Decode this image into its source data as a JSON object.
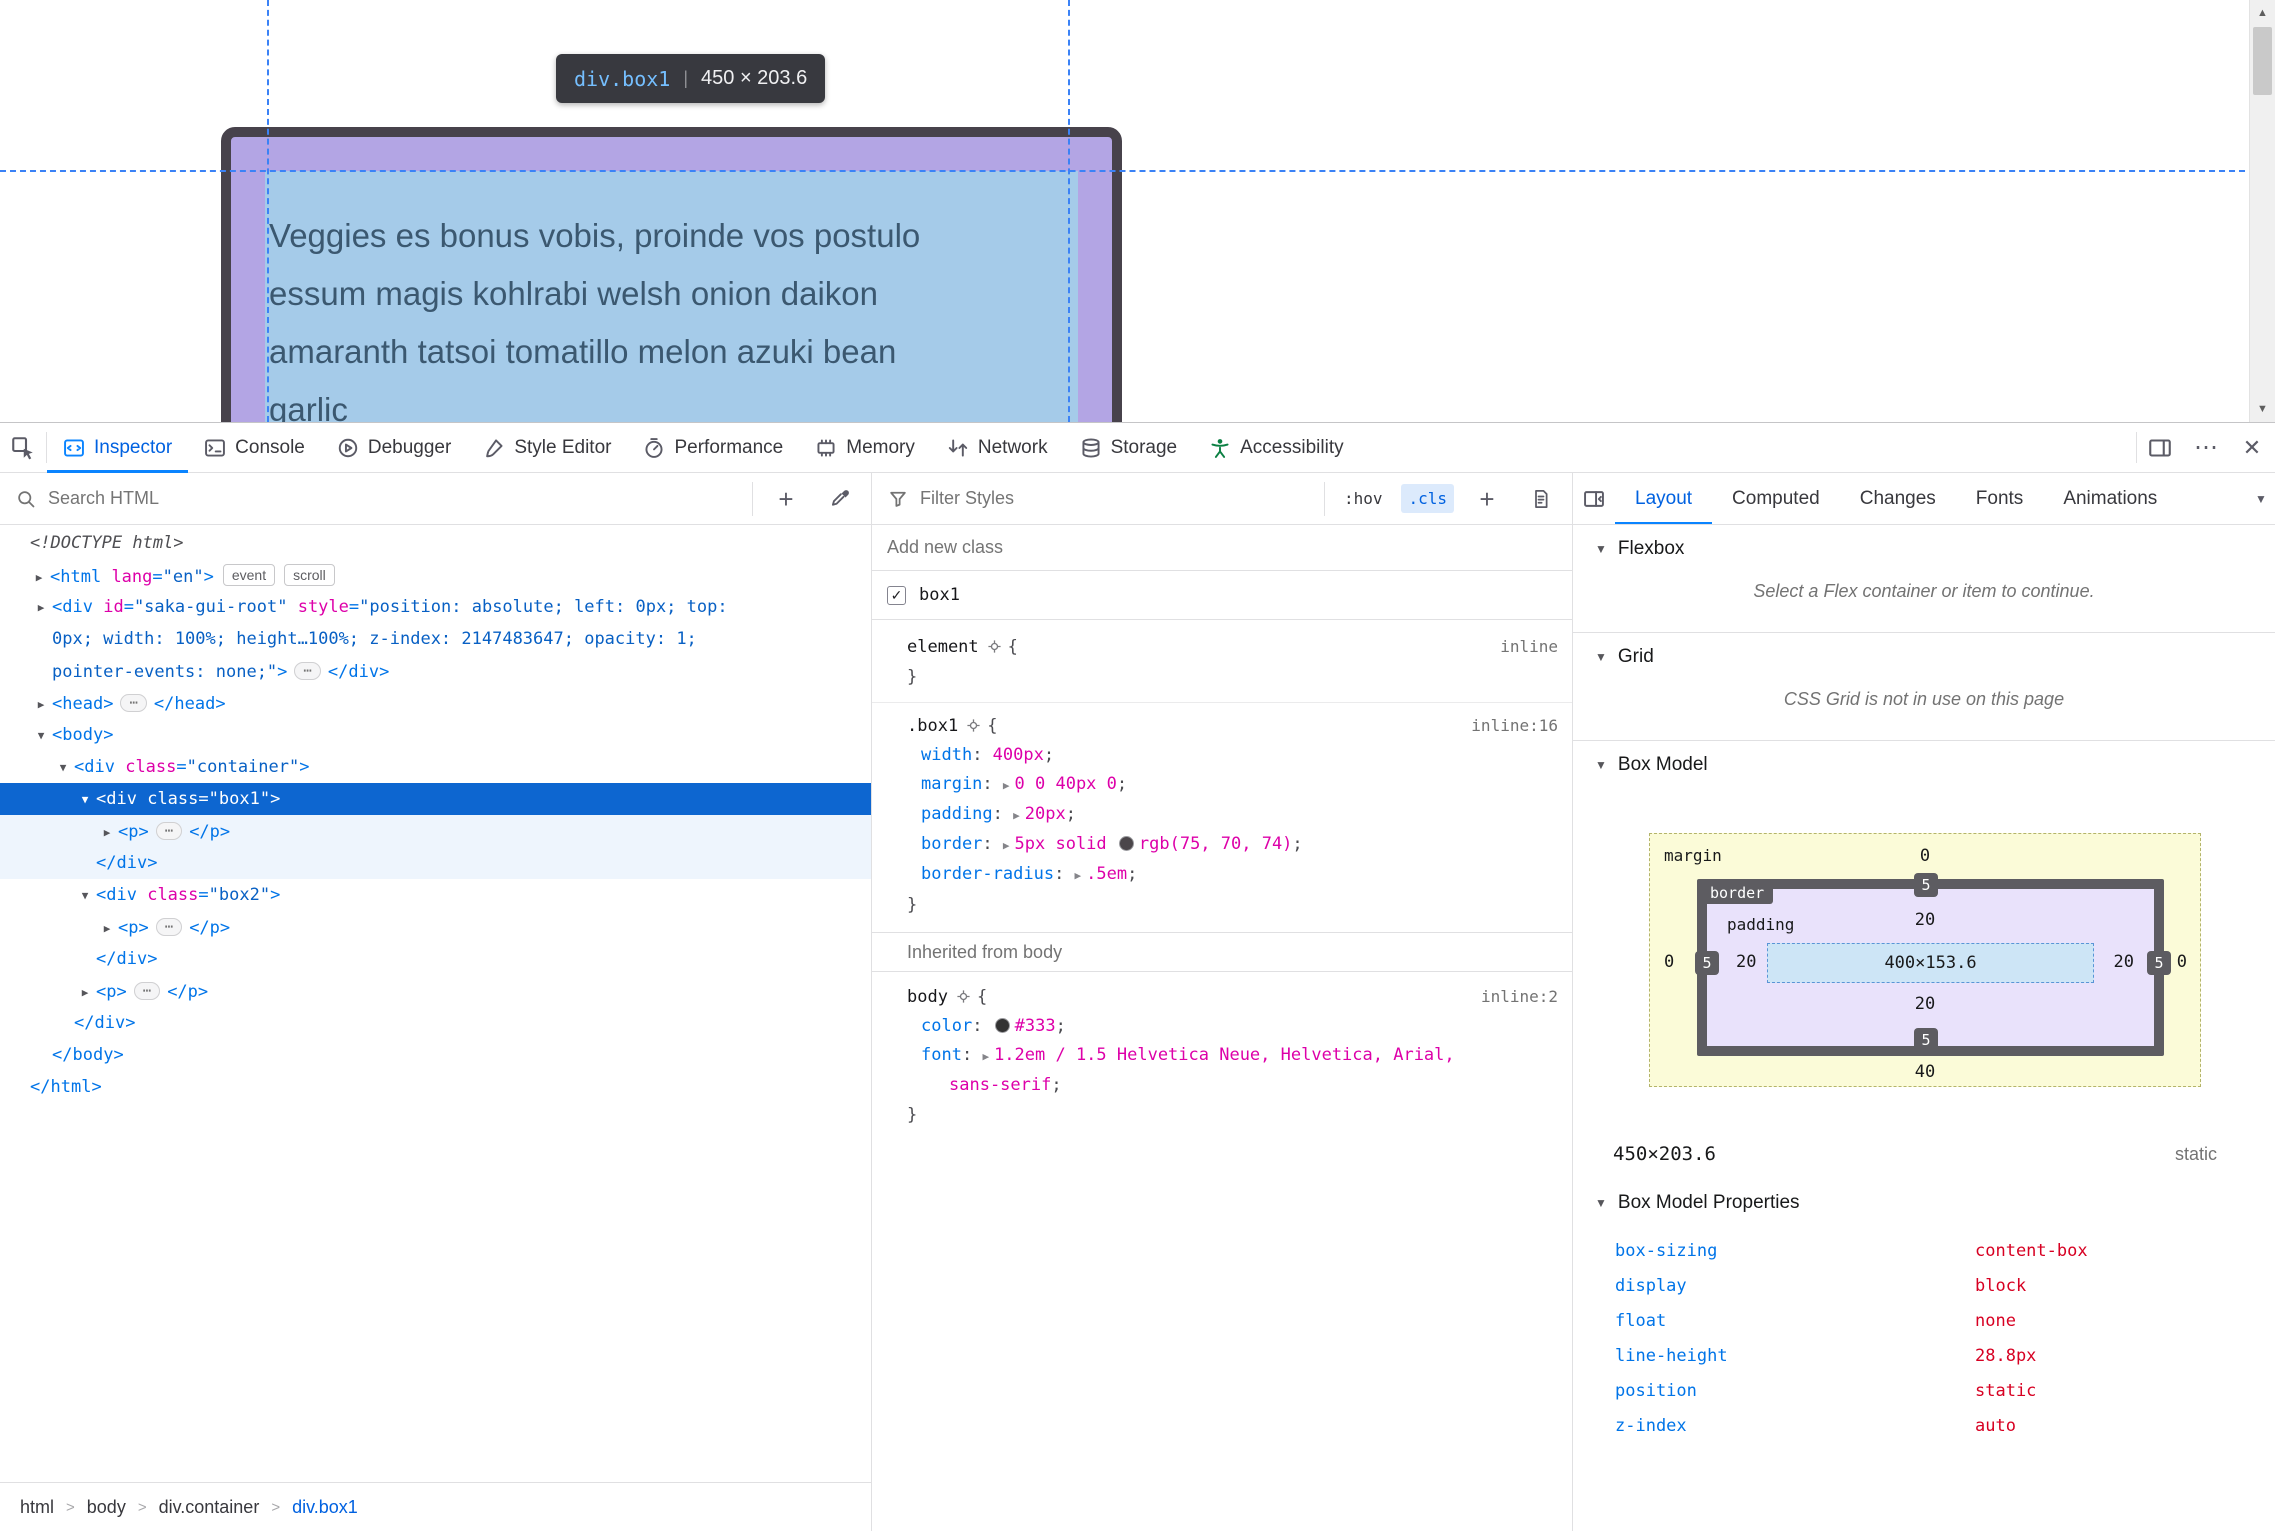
{
  "page": {
    "tooltip": {
      "selector": "div.box1",
      "separator": "|",
      "dims": "450 × 203.6"
    },
    "text_lines": [
      "Veggies es bonus vobis, proinde vos postulo",
      "essum magis kohlrabi welsh onion daikon",
      "amaranth tatsoi tomatillo melon azuki bean",
      "garlic"
    ]
  },
  "toolbar": {
    "tabs": [
      {
        "label": "Inspector",
        "active": true
      },
      {
        "label": "Console"
      },
      {
        "label": "Debugger"
      },
      {
        "label": "Style Editor"
      },
      {
        "label": "Performance"
      },
      {
        "label": "Memory"
      },
      {
        "label": "Network"
      },
      {
        "label": "Storage"
      },
      {
        "label": "Accessibility"
      }
    ],
    "meatball": "⋯",
    "close": "✕"
  },
  "markup": {
    "search_placeholder": "Search HTML",
    "rows": [
      {
        "indent": 30,
        "tokens": [
          {
            "t": "doctype",
            "s": "<!DOCTYPE html>"
          }
        ]
      },
      {
        "indent": 50,
        "arrow": "right",
        "tokens": [
          {
            "t": "p",
            "s": "<"
          },
          {
            "t": "tag",
            "s": "html"
          },
          {
            "t": "attr",
            "s": " lang"
          },
          {
            "t": "p",
            "s": "="
          },
          {
            "t": "val",
            "s": "\"en\""
          },
          {
            "t": "p",
            "s": ">"
          },
          {
            "t": "badge",
            "s": "event"
          },
          {
            "t": "badge",
            "s": "scroll"
          }
        ]
      },
      {
        "indent": 52,
        "arrow": "right",
        "tokens": [
          {
            "t": "p",
            "s": "<"
          },
          {
            "t": "tag",
            "s": "div"
          },
          {
            "t": "attr",
            "s": " id"
          },
          {
            "t": "p",
            "s": "="
          },
          {
            "t": "val",
            "s": "\"saka-gui-root\""
          },
          {
            "t": "attr",
            "s": " style"
          },
          {
            "t": "p",
            "s": "="
          },
          {
            "t": "val",
            "s": "\"position: absolute; left: 0px; top:"
          }
        ]
      },
      {
        "indent": 52,
        "tokens": [
          {
            "t": "val",
            "s": "0px; width: 100%; height…100%; z-index: 2147483647; opacity: 1;"
          }
        ]
      },
      {
        "indent": 52,
        "tokens": [
          {
            "t": "val",
            "s": "pointer-events: none;\""
          },
          {
            "t": "p",
            "s": ">"
          },
          {
            "t": "ell",
            "s": "⋯"
          },
          {
            "t": "p",
            "s": "</"
          },
          {
            "t": "tag",
            "s": "div"
          },
          {
            "t": "p",
            "s": ">"
          }
        ]
      },
      {
        "indent": 52,
        "arrow": "right",
        "tokens": [
          {
            "t": "p",
            "s": "<"
          },
          {
            "t": "tag",
            "s": "head"
          },
          {
            "t": "p",
            "s": ">"
          },
          {
            "t": "ell",
            "s": "⋯"
          },
          {
            "t": "p",
            "s": "</"
          },
          {
            "t": "tag",
            "s": "head"
          },
          {
            "t": "p",
            "s": ">"
          }
        ]
      },
      {
        "indent": 52,
        "arrow": "down",
        "tokens": [
          {
            "t": "p",
            "s": "<"
          },
          {
            "t": "tag",
            "s": "body"
          },
          {
            "t": "p",
            "s": ">"
          }
        ]
      },
      {
        "indent": 74,
        "arrow": "down",
        "tokens": [
          {
            "t": "p",
            "s": "<"
          },
          {
            "t": "tag",
            "s": "div"
          },
          {
            "t": "attr",
            "s": " class"
          },
          {
            "t": "p",
            "s": "="
          },
          {
            "t": "val",
            "s": "\"container\""
          },
          {
            "t": "p",
            "s": ">"
          }
        ]
      },
      {
        "indent": 96,
        "arrow": "down",
        "state": "selected",
        "tokens": [
          {
            "t": "p",
            "s": "<"
          },
          {
            "t": "tag",
            "s": "div"
          },
          {
            "t": "attr",
            "s": " class"
          },
          {
            "t": "p",
            "s": "="
          },
          {
            "t": "val",
            "s": "\"box1\""
          },
          {
            "t": "p",
            "s": ">"
          }
        ]
      },
      {
        "indent": 118,
        "arrow": "right",
        "state": "tint",
        "tokens": [
          {
            "t": "p",
            "s": "<"
          },
          {
            "t": "tag",
            "s": "p"
          },
          {
            "t": "p",
            "s": ">"
          },
          {
            "t": "ell",
            "s": "⋯"
          },
          {
            "t": "p",
            "s": "</"
          },
          {
            "t": "tag",
            "s": "p"
          },
          {
            "t": "p",
            "s": ">"
          }
        ]
      },
      {
        "indent": 96,
        "state": "tint",
        "tokens": [
          {
            "t": "p",
            "s": "</"
          },
          {
            "t": "tag",
            "s": "div"
          },
          {
            "t": "p",
            "s": ">"
          }
        ]
      },
      {
        "indent": 96,
        "arrow": "down",
        "tokens": [
          {
            "t": "p",
            "s": "<"
          },
          {
            "t": "tag",
            "s": "div"
          },
          {
            "t": "attr",
            "s": " class"
          },
          {
            "t": "p",
            "s": "="
          },
          {
            "t": "val",
            "s": "\"box2\""
          },
          {
            "t": "p",
            "s": ">"
          }
        ]
      },
      {
        "indent": 118,
        "arrow": "right",
        "tokens": [
          {
            "t": "p",
            "s": "<"
          },
          {
            "t": "tag",
            "s": "p"
          },
          {
            "t": "p",
            "s": ">"
          },
          {
            "t": "ell",
            "s": "⋯"
          },
          {
            "t": "p",
            "s": "</"
          },
          {
            "t": "tag",
            "s": "p"
          },
          {
            "t": "p",
            "s": ">"
          }
        ]
      },
      {
        "indent": 96,
        "tokens": [
          {
            "t": "p",
            "s": "</"
          },
          {
            "t": "tag",
            "s": "div"
          },
          {
            "t": "p",
            "s": ">"
          }
        ]
      },
      {
        "indent": 96,
        "arrow": "right",
        "tokens": [
          {
            "t": "p",
            "s": "<"
          },
          {
            "t": "tag",
            "s": "p"
          },
          {
            "t": "p",
            "s": ">"
          },
          {
            "t": "ell",
            "s": "⋯"
          },
          {
            "t": "p",
            "s": "</"
          },
          {
            "t": "tag",
            "s": "p"
          },
          {
            "t": "p",
            "s": ">"
          }
        ]
      },
      {
        "indent": 74,
        "tokens": [
          {
            "t": "p",
            "s": "</"
          },
          {
            "t": "tag",
            "s": "div"
          },
          {
            "t": "p",
            "s": ">"
          }
        ]
      },
      {
        "indent": 52,
        "tokens": [
          {
            "t": "p",
            "s": "</"
          },
          {
            "t": "tag",
            "s": "body"
          },
          {
            "t": "p",
            "s": ">"
          }
        ]
      },
      {
        "indent": 30,
        "tokens": [
          {
            "t": "p",
            "s": "</"
          },
          {
            "t": "tag",
            "s": "html"
          },
          {
            "t": "p",
            "s": ">"
          }
        ]
      }
    ],
    "breadcrumbs": [
      {
        "label": "html"
      },
      {
        "label": "body"
      },
      {
        "label": "div.container"
      },
      {
        "label": "div.box1",
        "active": true
      }
    ]
  },
  "rules": {
    "filter_placeholder": "Filter Styles",
    "hov": ":hov",
    "cls": ".cls",
    "add": "+",
    "add_class_placeholder": "Add new class",
    "classes": [
      {
        "name": "box1",
        "checked": true
      }
    ],
    "blocks": [
      {
        "selector": "element",
        "link": "inline",
        "sep": true,
        "props": []
      },
      {
        "selector": ".box1",
        "link": "inline:16",
        "props": [
          {
            "name": "width",
            "value": [
              {
                "text": "400px"
              }
            ]
          },
          {
            "name": "margin",
            "expand": true,
            "value": [
              {
                "text": "0 0 40px 0"
              }
            ]
          },
          {
            "name": "padding",
            "expand": true,
            "value": [
              {
                "text": "20px"
              }
            ]
          },
          {
            "name": "border",
            "expand": true,
            "value": [
              {
                "text": "5px solid "
              },
              {
                "swatch": "#4b464a"
              },
              {
                "text": "rgb(75, 70, 74)"
              }
            ]
          },
          {
            "name": "border-radius",
            "expand": true,
            "value": [
              {
                "text": ".5em"
              }
            ]
          }
        ]
      },
      {
        "heading": "Inherited from body"
      },
      {
        "selector": "body",
        "link": "inline:2",
        "props": [
          {
            "name": "color",
            "value": [
              {
                "swatch": "#333333"
              },
              {
                "text": "#333"
              }
            ]
          },
          {
            "name": "font",
            "expand": true,
            "value": [
              {
                "text": "1.2em / 1.5 Helvetica Neue, Helvetica, Arial, sans-serif"
              }
            ]
          }
        ]
      }
    ]
  },
  "layout": {
    "tabs": [
      {
        "label": "Layout",
        "active": true
      },
      {
        "label": "Computed"
      },
      {
        "label": "Changes"
      },
      {
        "label": "Fonts"
      },
      {
        "label": "Animations"
      }
    ],
    "flexbox": {
      "title": "Flexbox",
      "message": "Select a Flex container or item to continue."
    },
    "grid": {
      "title": "Grid",
      "message": "CSS Grid is not in use on this page"
    },
    "box_model": {
      "title": "Box Model",
      "margin_label": "margin",
      "border_label": "border",
      "padding_label": "padding",
      "margin": {
        "top": "0",
        "right": "0",
        "bottom": "40",
        "left": "0"
      },
      "border": {
        "top": "5",
        "right": "5",
        "bottom": "5",
        "left": "5"
      },
      "padding": {
        "top": "20",
        "right": "20",
        "bottom": "20",
        "left": "20"
      },
      "content": "400×153.6",
      "dimensions": "450×203.6",
      "position": "static"
    },
    "properties": {
      "title": "Box Model Properties",
      "items": [
        {
          "name": "box-sizing",
          "value": "content-box"
        },
        {
          "name": "display",
          "value": "block"
        },
        {
          "name": "float",
          "value": "none"
        },
        {
          "name": "line-height",
          "value": "28.8px"
        },
        {
          "name": "position",
          "value": "static"
        },
        {
          "name": "z-index",
          "value": "auto"
        }
      ]
    }
  }
}
